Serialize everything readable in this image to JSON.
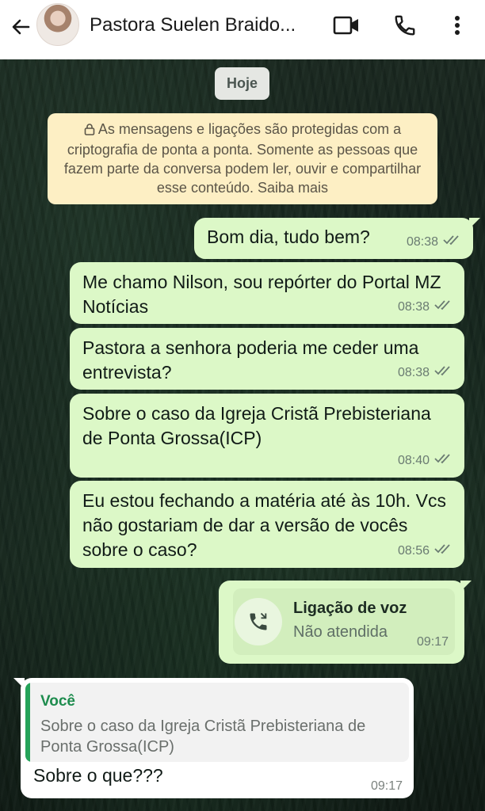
{
  "header": {
    "contact_name": "Pastora Suelen Braido...",
    "icons": [
      "back-arrow-icon",
      "video-call-icon",
      "voice-call-icon",
      "more-options-icon"
    ]
  },
  "date_chip": "Hoje",
  "encryption_notice": "As mensagens e ligações são protegidas com a criptografia de ponta a ponta. Somente as pessoas que fazem parte da conversa podem ler, ouvir e compartilhar esse conteúdo. Saiba mais",
  "messages": [
    {
      "text": "Bom dia, tudo bem?",
      "time": "08:38",
      "status": "read"
    },
    {
      "text": "Me chamo Nilson, sou repórter do Portal MZ Notícias",
      "time": "08:38",
      "status": "read"
    },
    {
      "text": "Pastora a senhora poderia me ceder uma entrevista?",
      "time": "08:38",
      "status": "read"
    },
    {
      "text": "Sobre o caso  da Igreja Cristã Prebisteriana de Ponta Grossa(ICP)",
      "time": "08:40",
      "status": "read"
    },
    {
      "text": "Eu estou fechando a matéria até às 10h. Vcs não gostariam de dar a versão de vocês sobre o caso?",
      "time": "08:56",
      "status": "read"
    }
  ],
  "call": {
    "title": "Ligação de voz",
    "status": "Não atendida",
    "time": "09:17"
  },
  "reply": {
    "quoted_author": "Você",
    "quoted_text": "Sobre o caso  da Igreja Cristã Prebisteriana de Ponta Grossa(ICP)",
    "text": "Sobre o que???",
    "time": "09:17"
  },
  "colors": {
    "outgoing_bubble": "#dcf8c7",
    "incoming_bubble": "#ffffff",
    "notice_bg": "#fdefc4",
    "quote_accent": "#25a35a"
  }
}
